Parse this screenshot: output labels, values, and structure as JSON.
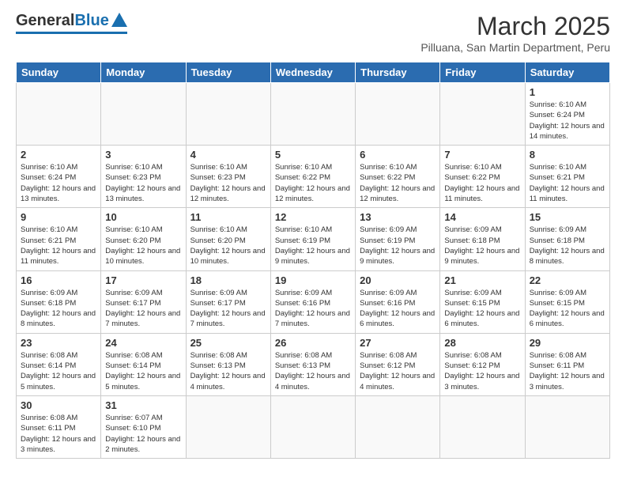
{
  "logo": {
    "general": "General",
    "blue": "Blue"
  },
  "header": {
    "title": "March 2025",
    "subtitle": "Pilluana, San Martin Department, Peru"
  },
  "weekdays": [
    "Sunday",
    "Monday",
    "Tuesday",
    "Wednesday",
    "Thursday",
    "Friday",
    "Saturday"
  ],
  "weeks": [
    [
      {
        "day": "",
        "info": ""
      },
      {
        "day": "",
        "info": ""
      },
      {
        "day": "",
        "info": ""
      },
      {
        "day": "",
        "info": ""
      },
      {
        "day": "",
        "info": ""
      },
      {
        "day": "",
        "info": ""
      },
      {
        "day": "1",
        "info": "Sunrise: 6:10 AM\nSunset: 6:24 PM\nDaylight: 12 hours and 14 minutes."
      }
    ],
    [
      {
        "day": "2",
        "info": "Sunrise: 6:10 AM\nSunset: 6:24 PM\nDaylight: 12 hours and 13 minutes."
      },
      {
        "day": "3",
        "info": "Sunrise: 6:10 AM\nSunset: 6:23 PM\nDaylight: 12 hours and 13 minutes."
      },
      {
        "day": "4",
        "info": "Sunrise: 6:10 AM\nSunset: 6:23 PM\nDaylight: 12 hours and 12 minutes."
      },
      {
        "day": "5",
        "info": "Sunrise: 6:10 AM\nSunset: 6:22 PM\nDaylight: 12 hours and 12 minutes."
      },
      {
        "day": "6",
        "info": "Sunrise: 6:10 AM\nSunset: 6:22 PM\nDaylight: 12 hours and 12 minutes."
      },
      {
        "day": "7",
        "info": "Sunrise: 6:10 AM\nSunset: 6:22 PM\nDaylight: 12 hours and 11 minutes."
      },
      {
        "day": "8",
        "info": "Sunrise: 6:10 AM\nSunset: 6:21 PM\nDaylight: 12 hours and 11 minutes."
      }
    ],
    [
      {
        "day": "9",
        "info": "Sunrise: 6:10 AM\nSunset: 6:21 PM\nDaylight: 12 hours and 11 minutes."
      },
      {
        "day": "10",
        "info": "Sunrise: 6:10 AM\nSunset: 6:20 PM\nDaylight: 12 hours and 10 minutes."
      },
      {
        "day": "11",
        "info": "Sunrise: 6:10 AM\nSunset: 6:20 PM\nDaylight: 12 hours and 10 minutes."
      },
      {
        "day": "12",
        "info": "Sunrise: 6:10 AM\nSunset: 6:19 PM\nDaylight: 12 hours and 9 minutes."
      },
      {
        "day": "13",
        "info": "Sunrise: 6:09 AM\nSunset: 6:19 PM\nDaylight: 12 hours and 9 minutes."
      },
      {
        "day": "14",
        "info": "Sunrise: 6:09 AM\nSunset: 6:18 PM\nDaylight: 12 hours and 9 minutes."
      },
      {
        "day": "15",
        "info": "Sunrise: 6:09 AM\nSunset: 6:18 PM\nDaylight: 12 hours and 8 minutes."
      }
    ],
    [
      {
        "day": "16",
        "info": "Sunrise: 6:09 AM\nSunset: 6:18 PM\nDaylight: 12 hours and 8 minutes."
      },
      {
        "day": "17",
        "info": "Sunrise: 6:09 AM\nSunset: 6:17 PM\nDaylight: 12 hours and 7 minutes."
      },
      {
        "day": "18",
        "info": "Sunrise: 6:09 AM\nSunset: 6:17 PM\nDaylight: 12 hours and 7 minutes."
      },
      {
        "day": "19",
        "info": "Sunrise: 6:09 AM\nSunset: 6:16 PM\nDaylight: 12 hours and 7 minutes."
      },
      {
        "day": "20",
        "info": "Sunrise: 6:09 AM\nSunset: 6:16 PM\nDaylight: 12 hours and 6 minutes."
      },
      {
        "day": "21",
        "info": "Sunrise: 6:09 AM\nSunset: 6:15 PM\nDaylight: 12 hours and 6 minutes."
      },
      {
        "day": "22",
        "info": "Sunrise: 6:09 AM\nSunset: 6:15 PM\nDaylight: 12 hours and 6 minutes."
      }
    ],
    [
      {
        "day": "23",
        "info": "Sunrise: 6:08 AM\nSunset: 6:14 PM\nDaylight: 12 hours and 5 minutes."
      },
      {
        "day": "24",
        "info": "Sunrise: 6:08 AM\nSunset: 6:14 PM\nDaylight: 12 hours and 5 minutes."
      },
      {
        "day": "25",
        "info": "Sunrise: 6:08 AM\nSunset: 6:13 PM\nDaylight: 12 hours and 4 minutes."
      },
      {
        "day": "26",
        "info": "Sunrise: 6:08 AM\nSunset: 6:13 PM\nDaylight: 12 hours and 4 minutes."
      },
      {
        "day": "27",
        "info": "Sunrise: 6:08 AM\nSunset: 6:12 PM\nDaylight: 12 hours and 4 minutes."
      },
      {
        "day": "28",
        "info": "Sunrise: 6:08 AM\nSunset: 6:12 PM\nDaylight: 12 hours and 3 minutes."
      },
      {
        "day": "29",
        "info": "Sunrise: 6:08 AM\nSunset: 6:11 PM\nDaylight: 12 hours and 3 minutes."
      }
    ],
    [
      {
        "day": "30",
        "info": "Sunrise: 6:08 AM\nSunset: 6:11 PM\nDaylight: 12 hours and 3 minutes."
      },
      {
        "day": "31",
        "info": "Sunrise: 6:07 AM\nSunset: 6:10 PM\nDaylight: 12 hours and 2 minutes."
      },
      {
        "day": "",
        "info": ""
      },
      {
        "day": "",
        "info": ""
      },
      {
        "day": "",
        "info": ""
      },
      {
        "day": "",
        "info": ""
      },
      {
        "day": "",
        "info": ""
      }
    ]
  ]
}
